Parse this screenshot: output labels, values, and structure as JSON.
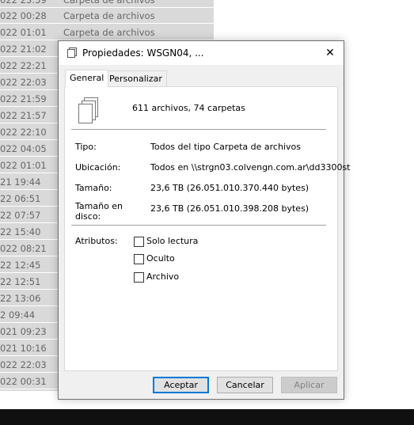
{
  "background": {
    "rows": [
      {
        "date": "022 23:59",
        "type": "Carpeta de archivos"
      },
      {
        "date": "022 00:28",
        "type": "Carpeta de archivos"
      },
      {
        "date": "022 01:01",
        "type": "Carpeta de archivos"
      },
      {
        "date": "022 21:02",
        "type": ""
      },
      {
        "date": "022 22:21",
        "type": ""
      },
      {
        "date": "022 22:03",
        "type": ""
      },
      {
        "date": "022 21:59",
        "type": ""
      },
      {
        "date": "022 21:57",
        "type": ""
      },
      {
        "date": "022 22:10",
        "type": ""
      },
      {
        "date": "022 04:05",
        "type": ""
      },
      {
        "date": "022 01:01",
        "type": ""
      },
      {
        "date": "21 19:44",
        "type": ""
      },
      {
        "date": "22 06:51",
        "type": ""
      },
      {
        "date": "22 07:57",
        "type": ""
      },
      {
        "date": "22 15:40",
        "type": ""
      },
      {
        "date": "022 08:21",
        "type": ""
      },
      {
        "date": "22 12:45",
        "type": ""
      },
      {
        "date": "22 12:51",
        "type": ""
      },
      {
        "date": "22 13:06",
        "type": ""
      },
      {
        "date": "2 09:44",
        "type": ""
      },
      {
        "date": "021 09:23",
        "type": ""
      },
      {
        "date": "021 10:16",
        "type": ""
      },
      {
        "date": "022 22:03",
        "type": ""
      },
      {
        "date": "022 00:31",
        "type": ""
      }
    ]
  },
  "dialog": {
    "title": "Propiedades: WSGN04, ...",
    "close_icon": "close-icon",
    "tabs": [
      {
        "label": "General",
        "active": true
      },
      {
        "label": "Personalizar",
        "active": false
      }
    ],
    "summary": "611 archivos, 74 carpetas",
    "fields": {
      "tipo_label": "Tipo:",
      "tipo_value": "Todos del tipo Carpeta de archivos",
      "ubicacion_label": "Ubicación:",
      "ubicacion_value": "Todos en \\\\strgn03.colvengn.com.ar\\dd3300st",
      "tamano_label": "Tamaño:",
      "tamano_value": "23,6 TB (26.051.010.370.440 bytes)",
      "tamano_disco_label_1": "Tamaño en",
      "tamano_disco_label_2": "disco:",
      "tamano_disco_value": "23,6 TB (26.051.010.398.208 bytes)"
    },
    "attributes": {
      "label": "Atributos:",
      "options": [
        {
          "label": "Solo lectura",
          "checked": false
        },
        {
          "label": "Oculto",
          "checked": false
        },
        {
          "label": "Archivo",
          "checked": false
        }
      ]
    },
    "buttons": {
      "ok": "Aceptar",
      "cancel": "Cancelar",
      "apply": "Aplicar"
    }
  },
  "colors": {
    "accent": "#0078d7",
    "list_background": "#d9d9d9",
    "taskbar": "#101010"
  }
}
